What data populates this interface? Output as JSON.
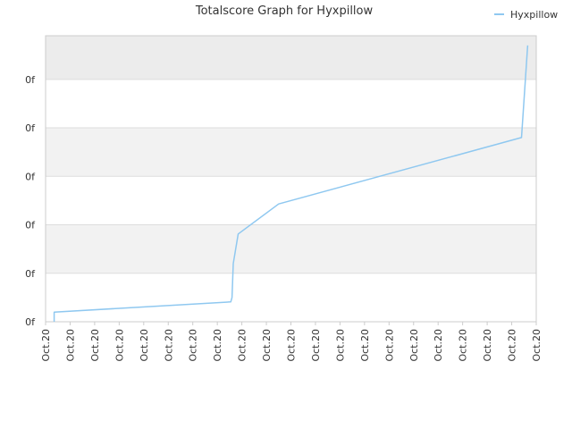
{
  "chart_data": {
    "type": "line",
    "title": "Totalscore Graph for Hyxpillow",
    "xlabel": "",
    "ylabel": "",
    "x_tick_labels": [
      "Oct.20",
      "Oct.20",
      "Oct.20",
      "Oct.20",
      "Oct.20",
      "Oct.20",
      "Oct.20",
      "Oct.20",
      "Oct.20",
      "Oct.20",
      "Oct.20",
      "Oct.20",
      "Oct.20",
      "Oct.20",
      "Oct.20",
      "Oct.20",
      "Oct.20",
      "Oct.20",
      "Oct.20",
      "Oct.20",
      "Oct.20"
    ],
    "y_tick_labels": [
      "0f",
      "0f",
      "0f",
      "0f",
      "0f",
      "0f"
    ],
    "legend": {
      "position": "top-right",
      "entries": [
        "Hyxpillow"
      ]
    },
    "grid": true,
    "colors": {
      "series": "#8fc8f0",
      "band": "#f2f2f2",
      "band_top": "#ececec",
      "grid": "#dddddd",
      "axis": "#cccccc"
    },
    "xlim": [
      0,
      20
    ],
    "ylim": [
      0,
      5.9
    ],
    "series": [
      {
        "name": "Hyxpillow",
        "x": [
          0.35,
          0.35,
          7.55,
          7.6,
          7.65,
          7.85,
          9.5,
          19.4,
          19.65
        ],
        "y": [
          0.0,
          0.2,
          0.41,
          0.5,
          1.2,
          1.81,
          2.43,
          3.8,
          5.7
        ]
      }
    ]
  }
}
